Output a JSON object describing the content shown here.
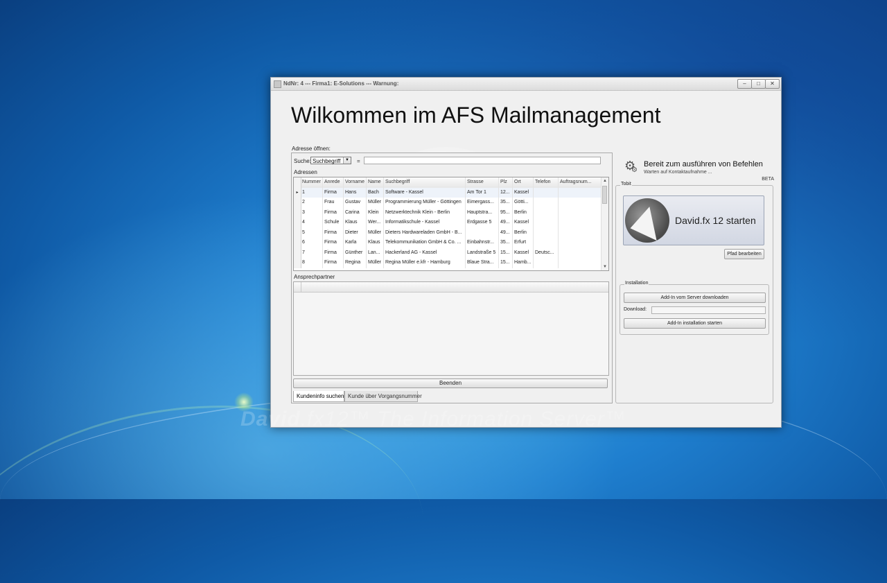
{
  "window": {
    "title": "NdNr: 4 --- Firma1: E-Solutions --- Warnung:",
    "controls": {
      "minimize": "‒",
      "maximize": "□",
      "close": "✕"
    }
  },
  "heading": "Wilkommen im AFS Mailmanagement",
  "address": {
    "open_label": "Adresse öffnen:",
    "search_label": "Suche:",
    "search_field": "Suchbegriff",
    "equals": "=",
    "search_value": "",
    "addresses_label": "Adressen",
    "columns": [
      "Nummer",
      "Anrede",
      "Vorname",
      "Name",
      "Suchbegriff",
      "Strasse",
      "Plz",
      "Ort",
      "Telefon",
      "Auftragsnum..."
    ],
    "rows": [
      {
        "marker": "▸",
        "nummer": "1",
        "anrede": "Firma",
        "vorname": "Hans",
        "name": "Bach",
        "suchbegriff": "Software - Kassel",
        "strasse": "Am Tor 1",
        "plz": "12...",
        "ort": "Kassel",
        "telefon": "",
        "auftrag": ""
      },
      {
        "marker": "",
        "nummer": "2",
        "anrede": "Frau",
        "vorname": "Gustav",
        "name": "Müller",
        "suchbegriff": "Programmierung Müller - Göttingen",
        "strasse": "Eimergass...",
        "plz": "35...",
        "ort": "Götti...",
        "telefon": "",
        "auftrag": ""
      },
      {
        "marker": "",
        "nummer": "3",
        "anrede": "Firma",
        "vorname": "Carina",
        "name": "Klein",
        "suchbegriff": "Netzwerktechnik Klein - Berlin",
        "strasse": "Hauptstra...",
        "plz": "95...",
        "ort": "Berlin",
        "telefon": "",
        "auftrag": ""
      },
      {
        "marker": "",
        "nummer": "4",
        "anrede": "Schule",
        "vorname": "Klaus",
        "name": "Wer...",
        "suchbegriff": "Informatikschule - Kassel",
        "strasse": "Erdgasse 5",
        "plz": "49...",
        "ort": "Kassel",
        "telefon": "",
        "auftrag": ""
      },
      {
        "marker": "",
        "nummer": "5",
        "anrede": "Firma",
        "vorname": "Dieter",
        "name": "Müller",
        "suchbegriff": "Dieters Hardwareladen GmbH - B...",
        "strasse": "",
        "plz": "49...",
        "ort": "Berlin",
        "telefon": "",
        "auftrag": ""
      },
      {
        "marker": "",
        "nummer": "6",
        "anrede": "Firma",
        "vorname": "Karla",
        "name": "Klaus",
        "suchbegriff": "Telekommunikation GmbH & Co. ...",
        "strasse": "Einbahnstr...",
        "plz": "35...",
        "ort": "Erfurt",
        "telefon": "",
        "auftrag": ""
      },
      {
        "marker": "",
        "nummer": "7",
        "anrede": "Firma",
        "vorname": "Günther",
        "name": "Lan...",
        "suchbegriff": "Hackerland AG - Kassel",
        "strasse": "Landstraße 5",
        "plz": "15...",
        "ort": "Kassel",
        "telefon": "Deutsc...",
        "auftrag": ""
      },
      {
        "marker": "",
        "nummer": "8",
        "anrede": "Firma",
        "vorname": "Regina",
        "name": "Müller",
        "suchbegriff": "Regina Müller e.kfr - Hamburg",
        "strasse": "Blaue Stra...",
        "plz": "15...",
        "ort": "Hamb...",
        "telefon": "",
        "auftrag": ""
      }
    ],
    "contacts_label": "Ansprechpartner",
    "quit_button": "Beenden",
    "tabs": [
      "Kundeninfo suchen",
      "Kunde über Vorgangsnummer"
    ]
  },
  "status": {
    "title": "Bereit zum ausführen von Befehlen",
    "subtitle": "Warten auf Kontaktaufnahme ...",
    "beta": "BETA"
  },
  "tobit": {
    "group_label": "Tobit",
    "start_button": "David.fx 12 starten",
    "path_button": "Pfad bearbeiten"
  },
  "installation": {
    "group_label": "Installation",
    "download_button": "Add-In vom Server downloaden",
    "download_label": "Download:",
    "install_button": "Add-In installation starten"
  },
  "brand": {
    "name": "David",
    "suffix": ".fx12",
    "tm1": "™",
    "tagline": " The Information Server",
    "tm2": "™"
  }
}
